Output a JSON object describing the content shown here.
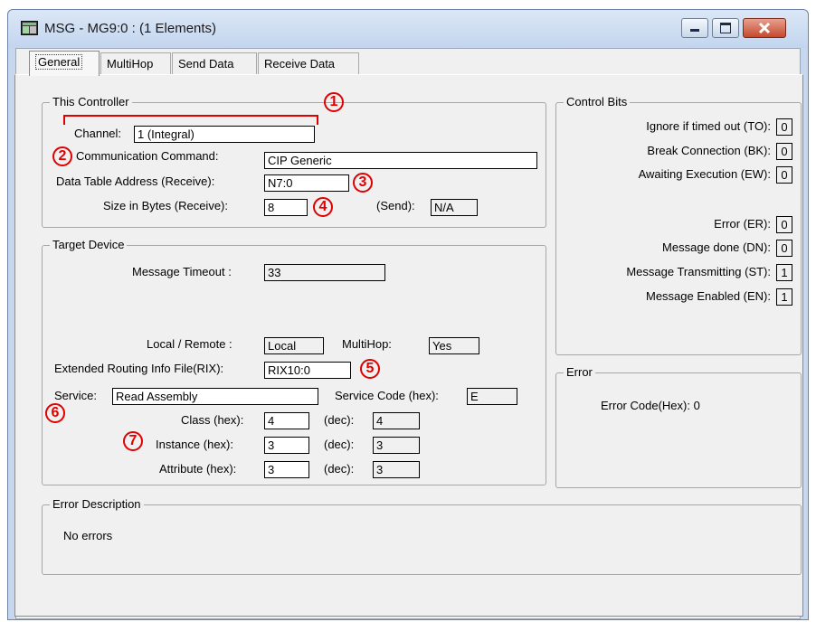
{
  "window": {
    "title": "MSG - MG9:0 : (1 Elements)"
  },
  "tabs": [
    {
      "label": "General"
    },
    {
      "label": "MultiHop"
    },
    {
      "label": "Send Data"
    },
    {
      "label": "Receive Data"
    }
  ],
  "this_controller": {
    "title": "This Controller",
    "channel_label": "Channel:",
    "channel_value": "1 (Integral)",
    "command_label": "Communication Command:",
    "command_value": "CIP Generic",
    "address_label": "Data Table Address (Receive):",
    "address_value": "N7:0",
    "size_label": "Size in Bytes (Receive):",
    "size_value": "8",
    "send_label": "(Send):",
    "send_value": "N/A"
  },
  "target_device": {
    "title": "Target Device",
    "timeout_label": "Message Timeout :",
    "timeout_value": "33",
    "local_remote_label": "Local / Remote :",
    "local_remote_value": "Local",
    "multihop_label": "MultiHop:",
    "multihop_value": "Yes",
    "rix_label": "Extended Routing Info File(RIX):",
    "rix_value": "RIX10:0",
    "service_label": "Service:",
    "service_value": "Read Assembly",
    "service_code_label": "Service Code (hex):",
    "service_code_value": "E",
    "class_label": "Class (hex):",
    "class_hex": "4",
    "class_dec": "4",
    "instance_label": "Instance (hex):",
    "instance_hex": "3",
    "instance_dec": "3",
    "attribute_label": "Attribute (hex):",
    "attribute_hex": "3",
    "attribute_dec": "3",
    "dec_label": "(dec):"
  },
  "control_bits": {
    "title": "Control Bits",
    "items": [
      {
        "label": "Ignore if timed out (TO):",
        "value": "0"
      },
      {
        "label": "Break Connection (BK):",
        "value": "0"
      },
      {
        "label": "Awaiting Execution (EW):",
        "value": "0"
      },
      {
        "label": "Error (ER):",
        "value": "0"
      },
      {
        "label": "Message done (DN):",
        "value": "0"
      },
      {
        "label": "Message Transmitting (ST):",
        "value": "1"
      },
      {
        "label": "Message Enabled (EN):",
        "value": "1"
      }
    ]
  },
  "error": {
    "title": "Error",
    "code_text": "Error Code(Hex): 0"
  },
  "error_description": {
    "title": "Error Description",
    "text": "No errors"
  },
  "callouts": [
    "1",
    "2",
    "3",
    "4",
    "5",
    "6",
    "7"
  ],
  "colors": {
    "callout": "#e00000",
    "title_bar": "#c7d8ee",
    "close_button": "#c44a2e"
  },
  "icons": {
    "app": "msg-window-icon",
    "minimize": "minimize-icon",
    "maximize": "maximize-icon",
    "close": "close-icon"
  }
}
